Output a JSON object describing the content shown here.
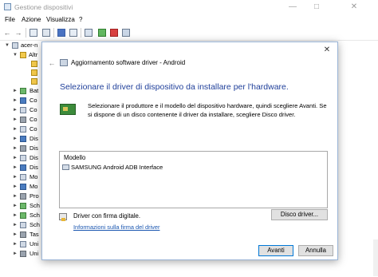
{
  "device_manager": {
    "title": "Gestione dispositivi",
    "menu": [
      "File",
      "Azione",
      "Visualizza",
      "?"
    ],
    "tree": {
      "root_label": "acer-n",
      "other_devices_label": "Altr",
      "categories": [
        "Bat",
        "Co",
        "Co",
        "Co",
        "Co",
        "Dis",
        "Dis",
        "Dis",
        "Dis",
        "Mo",
        "Mo",
        "Pro",
        "Sch",
        "Sch",
        "Sch",
        "Tas",
        "Uni",
        "Uni"
      ]
    }
  },
  "wizard": {
    "header_title": "Aggiornamento software driver - Android",
    "heading": "Selezionare il driver di dispositivo da installare per l'hardware.",
    "instructions": "Selezionare il produttore e il modello del dispositivo hardware, quindi scegliere Avanti. Se si dispone di un disco contenente il driver da installare, scegliere Disco driver.",
    "list_header": "Modello",
    "list_items": [
      "SAMSUNG Android ADB Interface"
    ],
    "signature_text": "Driver con firma digitale.",
    "signature_link": "Informazioni sulla firma del driver",
    "have_disk_button": "Disco driver...",
    "next_button": "Avanti",
    "cancel_button": "Annulla"
  }
}
